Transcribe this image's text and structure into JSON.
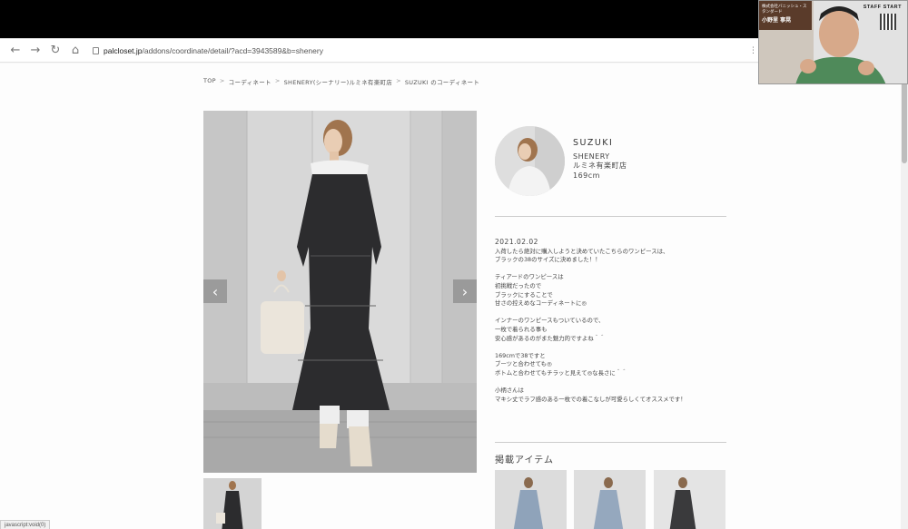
{
  "browser": {
    "url_domain": "palcloset.jp",
    "url_path": "/addons/coordinate/detail/?acd=3943589&b=shenery",
    "status_text": "javascript:void(0)"
  },
  "breadcrumb": [
    "TOP",
    "コーディネート",
    "SHENERY(シーナリー)ルミネ有楽町店",
    "SUZUKI のコーディネート"
  ],
  "breadcrumb_sep": ">",
  "profile": {
    "name": "SUZUKI",
    "brand": "SHENERY",
    "store": "ルミネ有楽町店",
    "height": "169cm"
  },
  "post": {
    "date": "2021.02.02",
    "body": [
      "入荷したら絶対に購入しようと決めていたこちらのワンピースは、",
      "ブラックの38のサイズに決めました！！",
      "",
      "ティアードのワンピースは",
      "初挑戦だったので",
      "ブラックにすることで",
      "甘さの控えめなコーディネートに◎",
      "",
      "インナーのワンピースもついているので、",
      "一枚で着られる事も",
      "安心感があるのがまた魅力的ですよね＾＾",
      "",
      "169cmで38ですと",
      "ブーツと合わせても◎",
      "ボトムと合わせてもチラッと見えて◎な長さに＾＾",
      "",
      "小柄さんは",
      "マキシ丈でラフ感のある一枚での着こなしが可愛らしくてオススメです！"
    ]
  },
  "items_title": "掲載アイテム",
  "gallery": {
    "prev_icon": "‹",
    "next_icon": "›"
  },
  "webcam": {
    "logo": "STAFF START",
    "banner_line": "株式会社バニッシュ・スタンダード",
    "person_name": "小野里 寧晃"
  },
  "colors": {
    "dress": "#2c2c2e",
    "wall": "#cfcfcf",
    "banner": "#5a3b2a"
  }
}
